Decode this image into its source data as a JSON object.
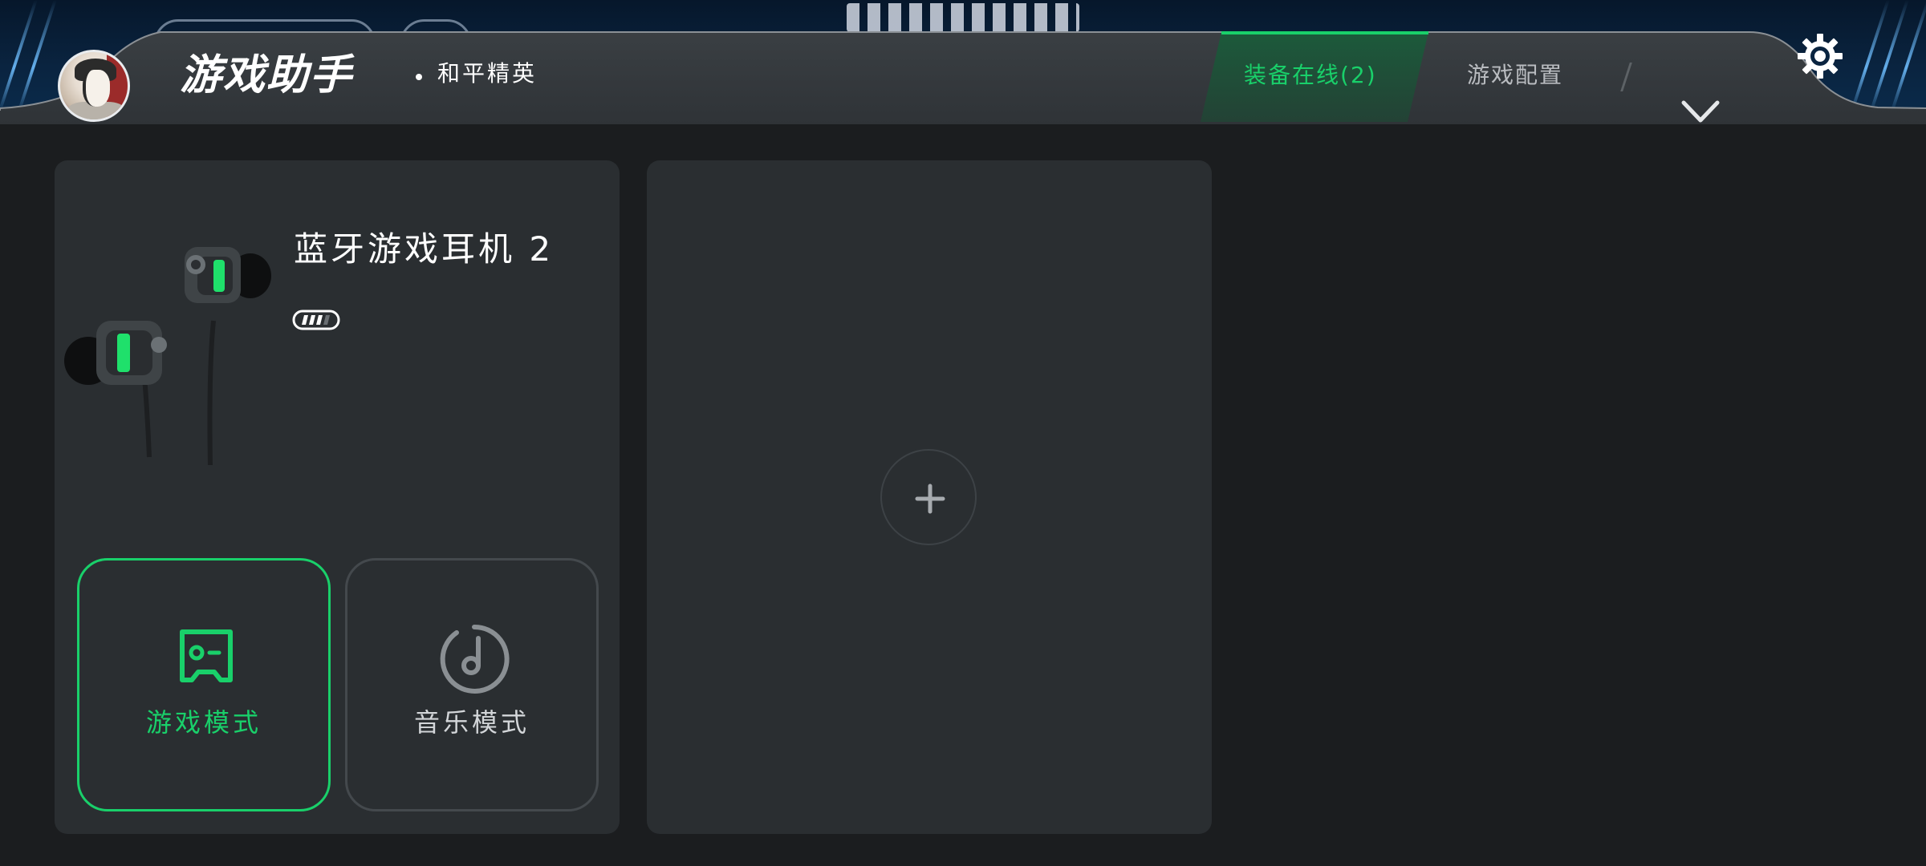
{
  "header": {
    "app_title": "游戏助手",
    "game_name": "和平精英",
    "tabs": [
      {
        "label": "装备在线(2)",
        "active": true
      },
      {
        "label": "游戏配置",
        "active": false
      }
    ],
    "icons": {
      "avatar": "avatar",
      "expand": "chevron-down-icon",
      "settings": "gear-icon"
    }
  },
  "device_card": {
    "device_name": "蓝牙游戏耳机 2",
    "battery_level": 0.75,
    "image": "earbuds-image",
    "modes": [
      {
        "label": "游戏模式",
        "icon": "gamepad-icon",
        "selected": true
      },
      {
        "label": "音乐模式",
        "icon": "music-note-icon",
        "selected": false
      }
    ]
  },
  "add_card": {
    "icon": "plus-icon"
  },
  "colors": {
    "accent": "#19d06a",
    "background": "#1b1d1f",
    "card": "#2a2e31",
    "header": "#33383c",
    "text_primary": "#ffffff",
    "text_secondary": "#b9bcc0"
  }
}
